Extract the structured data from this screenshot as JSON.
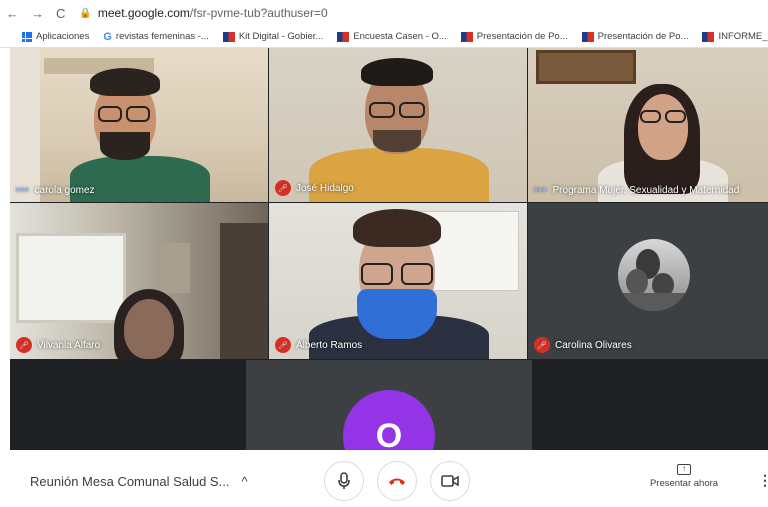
{
  "browser": {
    "nav_back": "←",
    "nav_forward": "→",
    "nav_reload": "C",
    "url_domain": "meet.google.com",
    "url_path": "/fsr-pvme-tub?authuser=0"
  },
  "bookmarks": [
    {
      "label": "Aplicaciones",
      "icon": "apps-icon"
    },
    {
      "label": "revistas femeninas -...",
      "icon": "google-icon"
    },
    {
      "label": "Kit Digital - Gobier...",
      "icon": "flag-icon"
    },
    {
      "label": "Encuesta Casen - O...",
      "icon": "flag-icon"
    },
    {
      "label": "Presentación de Po...",
      "icon": "flag-icon"
    },
    {
      "label": "Presentación de Po...",
      "icon": "flag-icon"
    },
    {
      "label": "INFORME_COQUIM...",
      "icon": "flag-icon"
    }
  ],
  "participants": [
    {
      "name": "carola gomez",
      "status": "speaking"
    },
    {
      "name": "José Hidalgo",
      "status": "muted"
    },
    {
      "name": "Programa Mujer, Sexualidad y Maternidad",
      "status": "speaking"
    },
    {
      "name": "Vilvania Alfaro",
      "status": "muted"
    },
    {
      "name": "Alberto Ramos",
      "status": "muted"
    },
    {
      "name": "Carolina Olivares",
      "status": "muted"
    }
  ],
  "self_avatar_letter": "O",
  "bottom_bar": {
    "meeting_title": "Reunión Mesa Comunal Salud S...",
    "expand_chevron": "^",
    "present_label": "Presentar ahora",
    "more_label": "⋮"
  },
  "colors": {
    "muted_badge": "#d93025",
    "speaking_dots": "#8ab4f8",
    "avatar_purple": "#9334e6"
  }
}
